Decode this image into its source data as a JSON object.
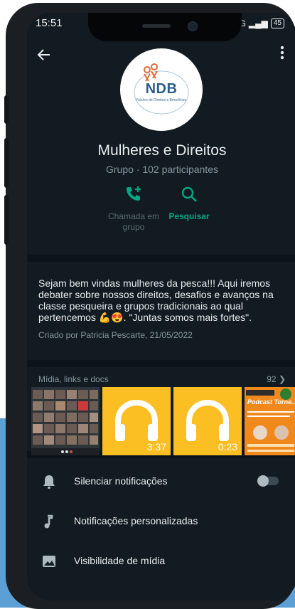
{
  "status_bar": {
    "time": "15:51",
    "network": "4G",
    "battery": "45"
  },
  "group": {
    "logo_text": "NDB",
    "logo_subtitle": "Núcleo de Direitos e Benefícios",
    "name": "Mulheres e Direitos",
    "meta": "Grupo · 102 participantes"
  },
  "actions": [
    {
      "label": "Chamada em grupo",
      "icon": "add-call-icon"
    },
    {
      "label": "Pesquisar",
      "icon": "search-icon"
    }
  ],
  "description": {
    "text": "Sejam bem vindas mulheres da pesca!!! Aqui iremos debater sobre nossos direitos, desafios e avanços na classe pesqueira e  grupos tradicionais ao qual pertencemos 💪😍. \"Juntas somos mais fortes\".",
    "created_by": "Criado por Patricia Pescarte, 21/05/2022"
  },
  "media": {
    "title": "Mídia, links e docs",
    "count": "92",
    "items": [
      {
        "type": "image",
        "icon": "video-call-grid-thumbnail"
      },
      {
        "type": "audio",
        "duration": "3:37",
        "icon": "headphones-icon"
      },
      {
        "type": "audio",
        "duration": "0:23",
        "icon": "headphones-icon"
      },
      {
        "type": "image",
        "icon": "podcast-flyer-thumbnail",
        "text": "Podcast Torne..."
      }
    ]
  },
  "settings": [
    {
      "label": "Silenciar notificações",
      "icon": "bell-icon"
    },
    {
      "label": "Notificações personalizadas",
      "icon": "music-note-icon"
    },
    {
      "label": "Visibilidade de mídia",
      "icon": "image-icon"
    }
  ],
  "colors": {
    "accent": "#00a884",
    "panel": "#111b21",
    "background": "#0b141a",
    "audio_thumb": "#fbbf24"
  }
}
